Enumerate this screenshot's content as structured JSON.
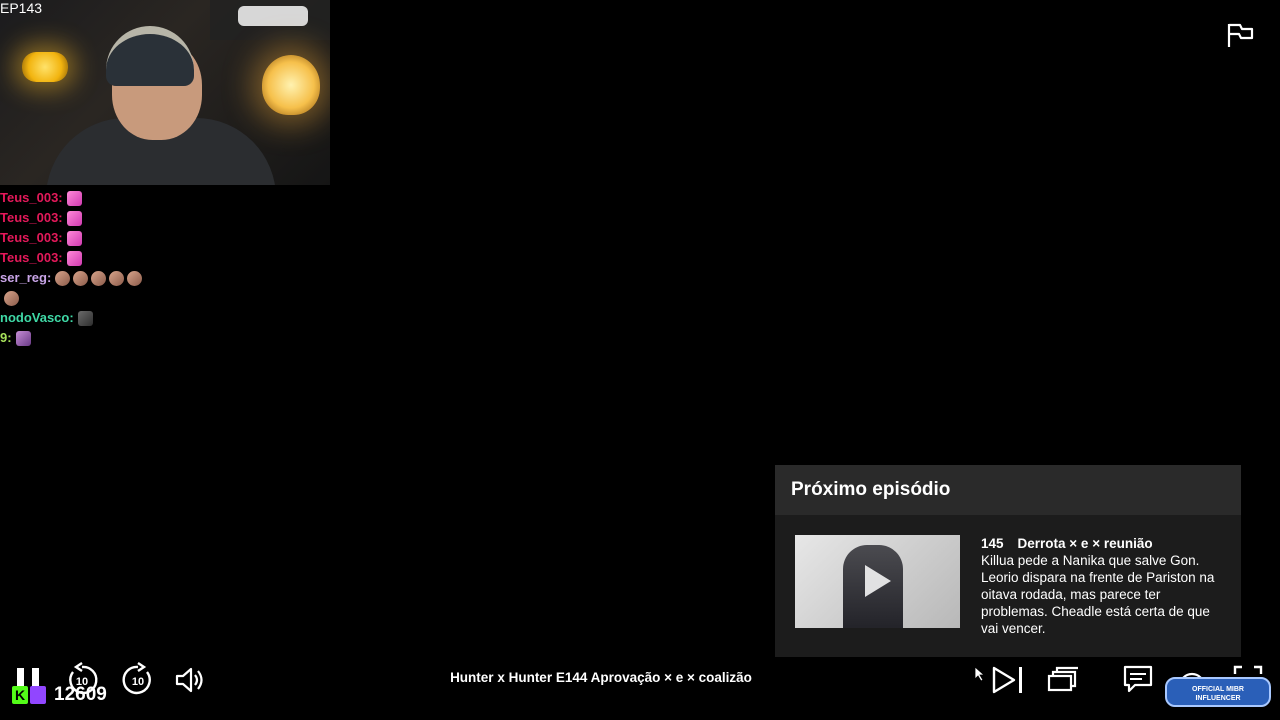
{
  "stream": {
    "episode_label": "EP143",
    "viewer_count": "12609",
    "official_badge_line1": "OFFICIAL MIBR",
    "official_badge_line2": "INFLUENCER"
  },
  "chat": [
    {
      "name": "Teus_003:",
      "color": "#e3195a",
      "emotes": [
        "pink"
      ]
    },
    {
      "name": "Teus_003:",
      "color": "#e3195a",
      "emotes": [
        "pink"
      ]
    },
    {
      "name": "Teus_003:",
      "color": "#e3195a",
      "emotes": [
        "pink"
      ]
    },
    {
      "name": "Teus_003:",
      "color": "#e3195a",
      "emotes": [
        "pink"
      ]
    },
    {
      "name": "ser_reg:",
      "color": "#c8a4e6",
      "emotes": [
        "tan",
        "tan",
        "tan",
        "tan",
        "tan"
      ]
    },
    {
      "name": "",
      "color": "#c8a4e6",
      "emotes": [
        "tan"
      ]
    },
    {
      "name": "nodoVasco:",
      "color": "#3fd9a6",
      "emotes": [
        "face"
      ]
    },
    {
      "name": "9:",
      "color": "#a6e05a",
      "emotes": [
        "purple"
      ]
    }
  ],
  "player": {
    "title": "Hunter x Hunter E144  Aprovação × e × coalizão",
    "next_episode": {
      "header": "Próximo episódio",
      "number": "145",
      "title": "Derrota × e × reunião",
      "description": "Killua pede a Nanika que salve Gon. Leorio dispara na frente de Pariston na oitava rodada, mas parece ter problemas. Cheadle está certa de que vai vencer."
    }
  },
  "icons": {
    "flag": "flag-icon",
    "pause": "pause-icon",
    "rewind": "rewind-10-icon",
    "forward": "forward-10-icon",
    "volume": "volume-icon",
    "next": "next-episode-icon",
    "episodes": "episodes-icon",
    "subtitles": "subtitles-icon",
    "speed": "playback-speed-icon",
    "fullscreen": "fullscreen-icon"
  }
}
